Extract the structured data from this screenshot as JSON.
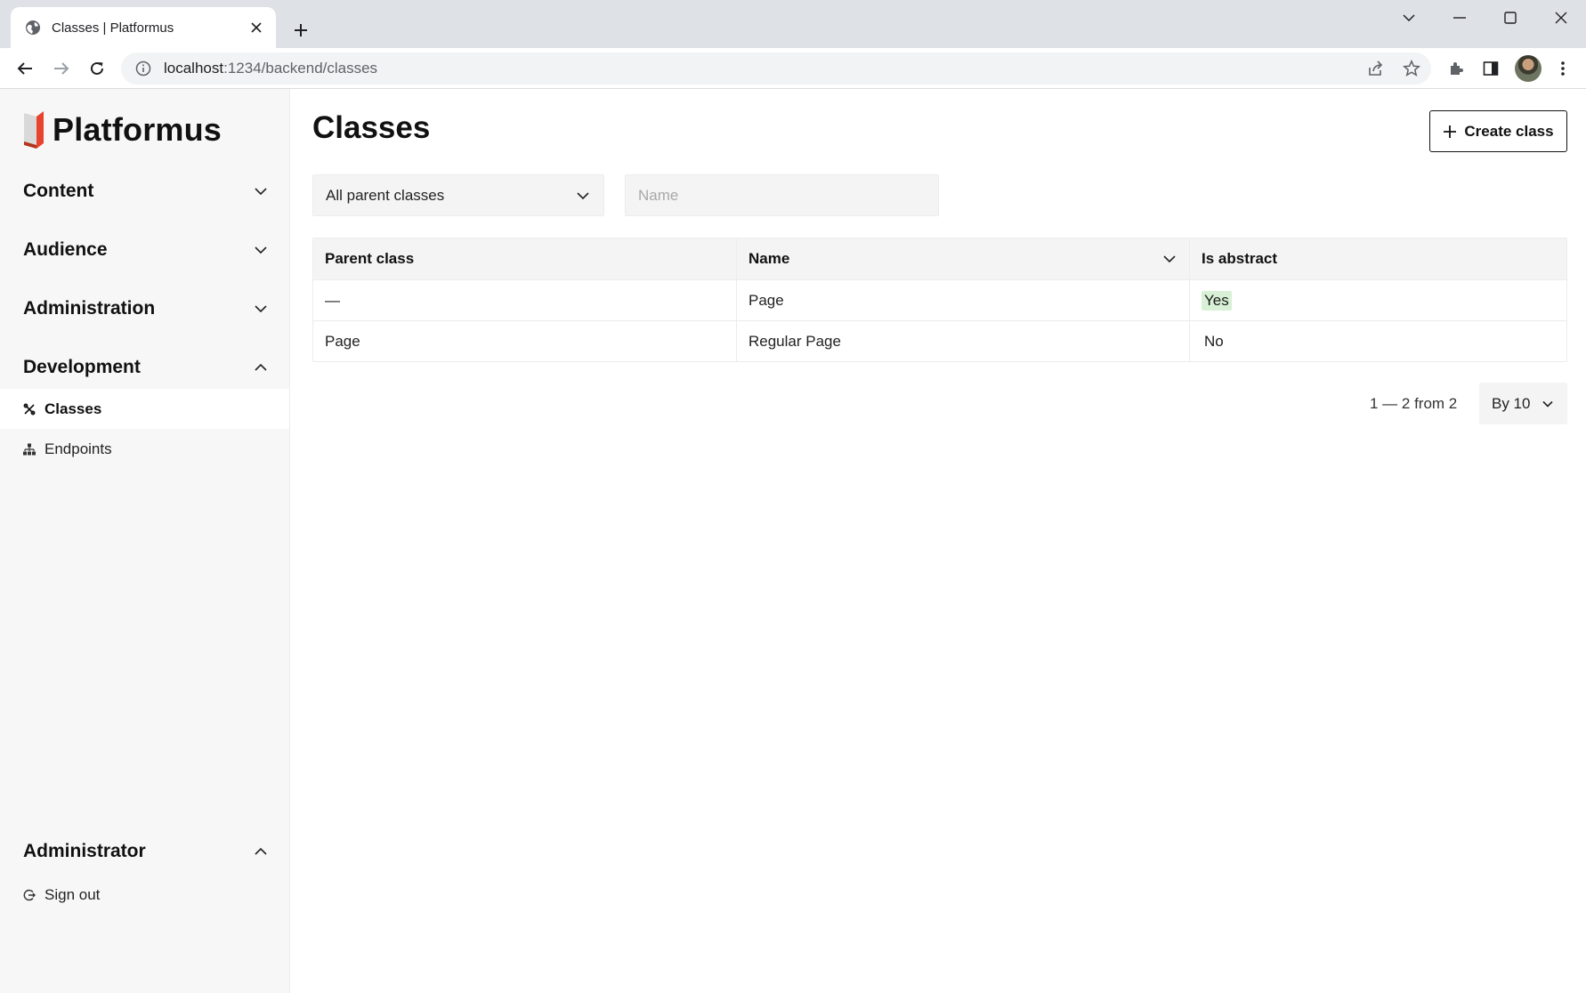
{
  "browser": {
    "tab_title": "Classes | Platformus",
    "url_host": "localhost",
    "url_path": ":1234/backend/classes"
  },
  "sidebar": {
    "logo_text": "Platformus",
    "sections": [
      {
        "title": "Content",
        "expanded": false
      },
      {
        "title": "Audience",
        "expanded": false
      },
      {
        "title": "Administration",
        "expanded": false
      },
      {
        "title": "Development",
        "expanded": true
      }
    ],
    "dev_items": [
      {
        "label": "Classes",
        "icon": "classes-icon",
        "active": true
      },
      {
        "label": "Endpoints",
        "icon": "endpoints-icon",
        "active": false
      }
    ],
    "account": {
      "title": "Administrator",
      "sign_out": "Sign out"
    }
  },
  "main": {
    "title": "Classes",
    "create_label": "Create class",
    "filter": {
      "parent_select": "All parent classes",
      "name_placeholder": "Name"
    },
    "table": {
      "headers": [
        "Parent class",
        "Name",
        "Is abstract"
      ],
      "rows": [
        [
          "—",
          "Page",
          "Yes"
        ],
        [
          "Page",
          "Regular Page",
          "No"
        ]
      ]
    },
    "pager": {
      "summary": "1 — 2 from 2",
      "per_page": "By 10"
    }
  },
  "colors": {
    "accent_logo": "#e8432f",
    "yes_badge": "#d8f1d6"
  }
}
